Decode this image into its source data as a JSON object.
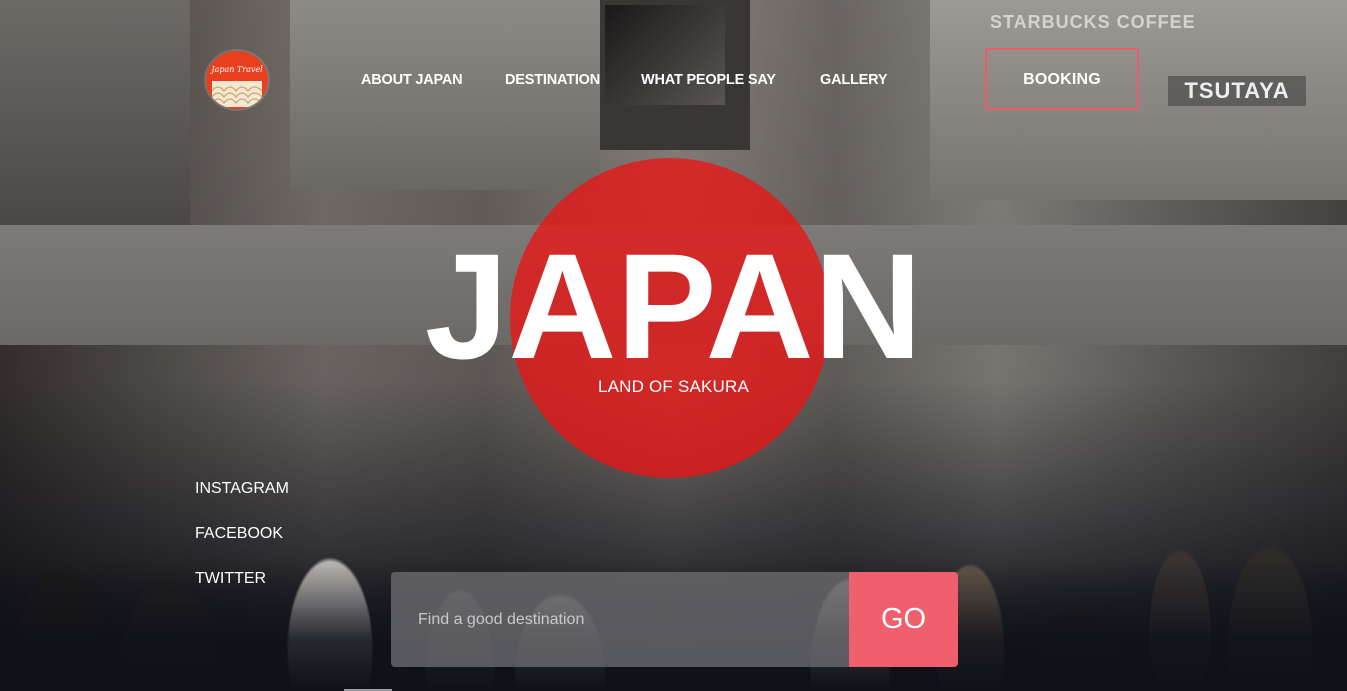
{
  "header": {
    "logo_text": "Japan Travel",
    "nav": [
      "ABOUT JAPAN",
      "DESTINATION",
      "WHAT PEOPLE SAY",
      "GALLERY"
    ],
    "booking_label": "BOOKING",
    "accent_color": "#f05a68"
  },
  "hero": {
    "title": "JAPAN",
    "subtitle": "LAND OF SAKURA",
    "sun_color": "#eb1414"
  },
  "social": {
    "items": [
      "INSTAGRAM",
      "FACEBOOK",
      "TWITTER"
    ]
  },
  "search": {
    "placeholder": "Find a good destination",
    "button_label": "GO",
    "button_color": "#f0606c"
  },
  "background_signs": {
    "starbucks": "STARBUCKS COFFEE",
    "tsutaya": "TSUTAYA"
  }
}
